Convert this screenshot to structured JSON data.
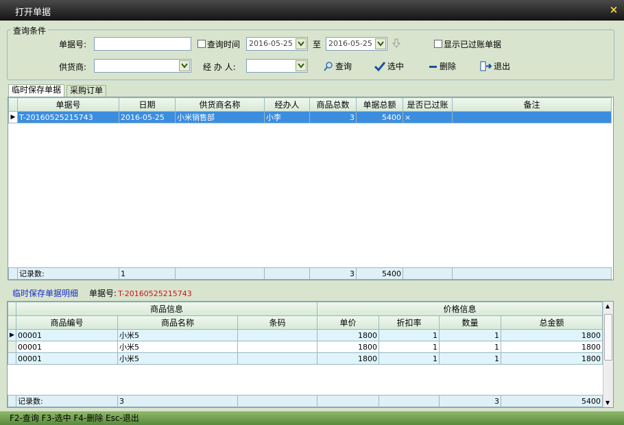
{
  "window": {
    "title": "打开单据",
    "close": "×"
  },
  "query": {
    "group_title": "查询条件",
    "bill_no_label": "单据号:",
    "query_time_label": "查询时间",
    "date_from": "2016-05-25",
    "to_label": "至",
    "date_to": "2016-05-25",
    "show_posted_label": "显示已过账单据",
    "supplier_label": "供货商:",
    "handler_label": "经 办 人:",
    "search_btn": "查询",
    "select_btn": "选中",
    "delete_btn": "删除",
    "exit_btn": "退出"
  },
  "tabs": [
    "临时保存单据",
    "采购订单"
  ],
  "main_grid": {
    "columns": [
      "单据号",
      "日期",
      "供货商名称",
      "经办人",
      "商品总数",
      "单据总额",
      "是否已过账",
      "备注"
    ],
    "rows": [
      {
        "bill_no": "T-20160525215743",
        "date": "2016-05-25",
        "supplier": "小米销售部",
        "handler": "小李",
        "qty": "3",
        "total": "5400",
        "posted": "×",
        "note": ""
      }
    ],
    "footer": {
      "label": "记录数:",
      "count": "1",
      "qty": "3",
      "total": "5400"
    }
  },
  "detail": {
    "title": "临时保存单据明细",
    "bill_label": "单据号:",
    "bill_no": "T-20160525215743",
    "group1": "商品信息",
    "group2": "价格信息",
    "columns": [
      "商品编号",
      "商品名称",
      "条码",
      "单价",
      "折扣率",
      "数量",
      "总金额"
    ],
    "rows": [
      {
        "code": "00001",
        "name": "小米5",
        "barcode": "",
        "price": "1800",
        "discount": "1",
        "qty": "1",
        "amount": "1800"
      },
      {
        "code": "00001",
        "name": "小米5",
        "barcode": "",
        "price": "1800",
        "discount": "1",
        "qty": "1",
        "amount": "1800"
      },
      {
        "code": "00001",
        "name": "小米5",
        "barcode": "",
        "price": "1800",
        "discount": "1",
        "qty": "1",
        "amount": "1800"
      }
    ],
    "footer": {
      "label": "记录数:",
      "count": "3",
      "qty": "3",
      "amount": "5400"
    }
  },
  "status": "F2-查询 F3-选中 F4-删除 Esc-退出",
  "colors": {
    "accent": "#3b8de0",
    "bill_red": "#d01010",
    "detail_blue": "#1a2cc8"
  }
}
